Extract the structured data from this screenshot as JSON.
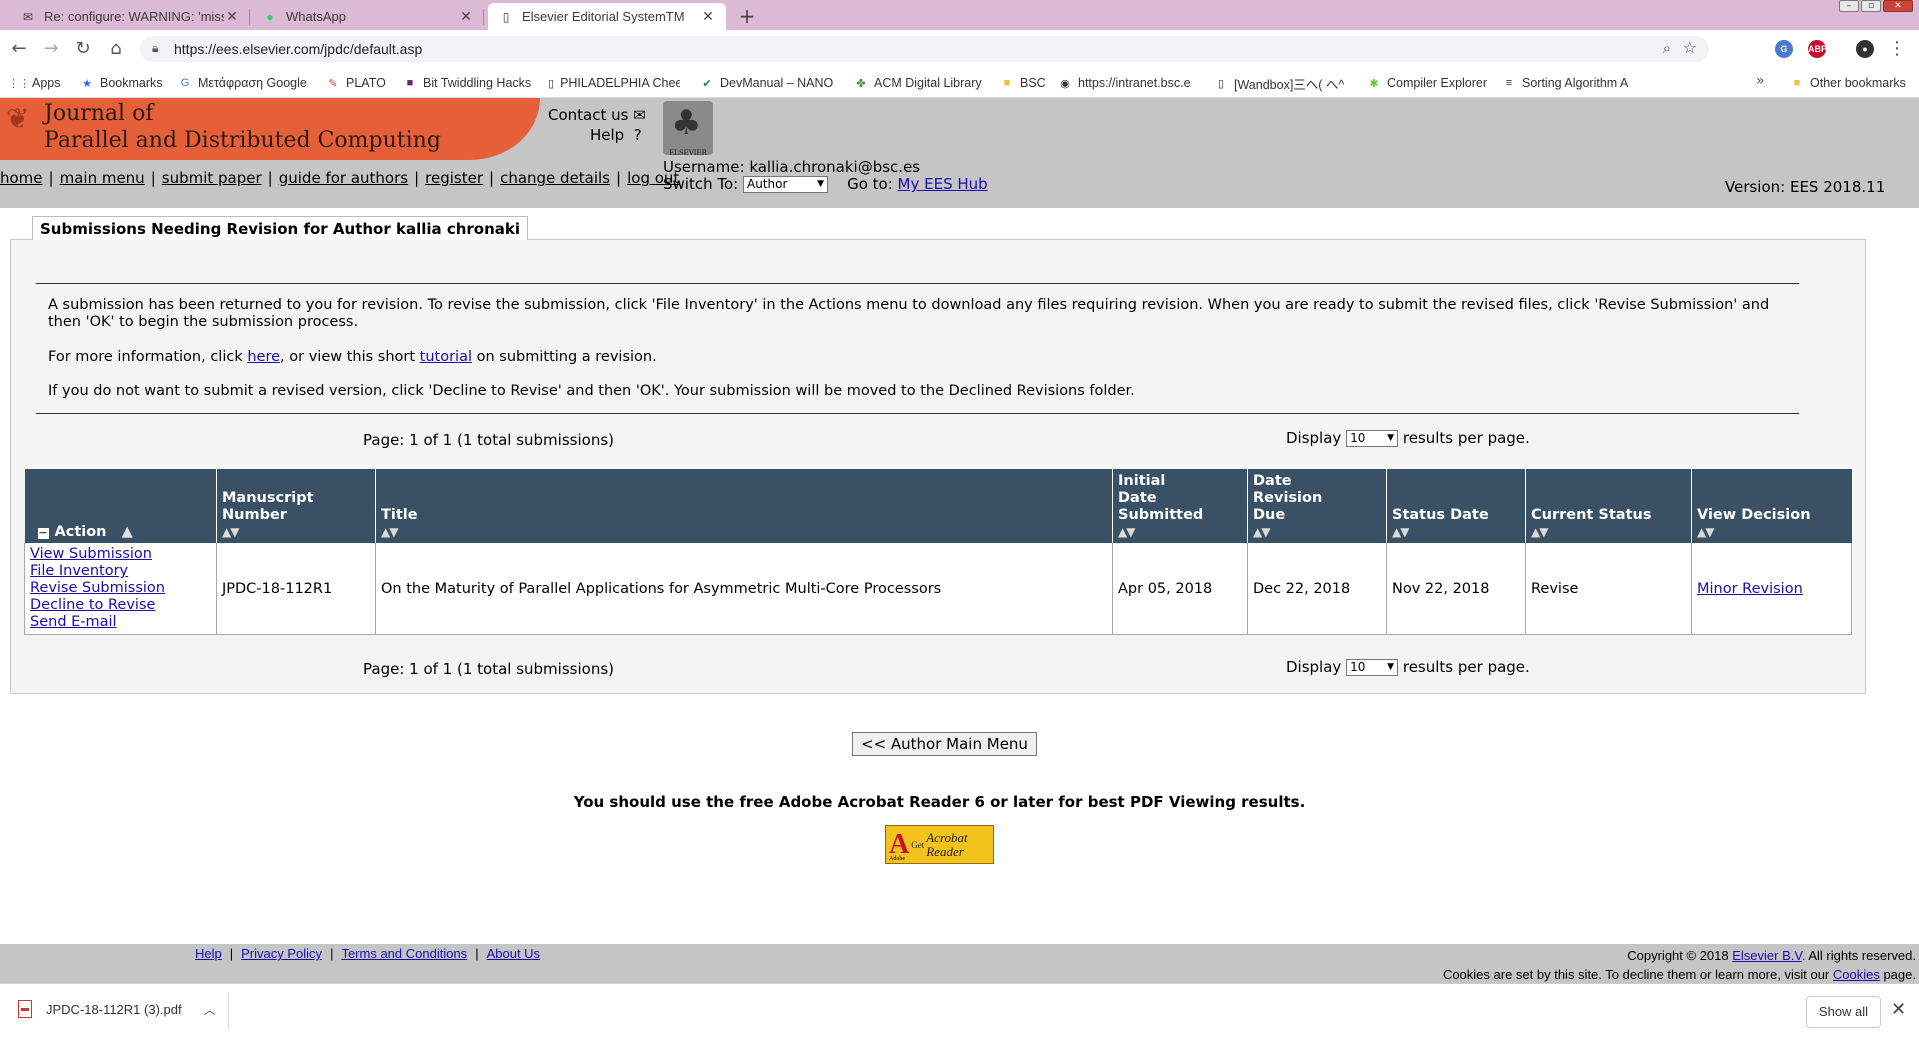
{
  "browser": {
    "tabs": [
      {
        "title": "Re: configure: WARNING: 'missin",
        "icon": "mail-icon"
      },
      {
        "title": "WhatsApp",
        "icon": "whatsapp-icon"
      },
      {
        "title": "Elsevier Editorial SystemTM",
        "icon": "page-icon"
      }
    ],
    "url": "https://ees.elsevier.com/jpdc/default.asp",
    "bookmarks": [
      "Apps",
      "Bookmarks",
      "Μετάφραση Google",
      "PLATO",
      "Bit Twiddling Hacks",
      "PHILADELPHIA Chee",
      "DevManual – NANO",
      "ACM Digital Library",
      "BSC",
      "https://intranet.bsc.e",
      "[Wandbox]三へ( へ^",
      "Compiler Explorer",
      "Sorting Algorithm A"
    ],
    "other_bookmarks": "Other bookmarks",
    "ext_abp": "ABP"
  },
  "header": {
    "journal_line1": "Journal of",
    "journal_line2": "Parallel and Distributed Computing",
    "contact": "Contact us",
    "help": "Help",
    "help_glyph": "?",
    "logo_text": "ELSEVIER",
    "username_label": "Username:",
    "username": "kallia.chronaki@bsc.es",
    "switch_label": "Switch To:",
    "switch_value": "Author",
    "goto_label": "Go to:",
    "hub_link": "My EES Hub",
    "version": "Version: EES 2018.11",
    "nav": [
      "home",
      "main menu",
      "submit paper",
      "guide for authors",
      "register",
      "change details",
      "log out"
    ]
  },
  "content": {
    "title": "Submissions Needing Revision for Author kallia chronaki",
    "para1": "A submission has been returned to you for revision. To revise the submission, click 'File Inventory' in the Actions menu to download any files requiring revision. When you are ready to submit the revised files, click 'Revise Submission' and then 'OK' to begin the submission process.",
    "para2_pre": "For more information, click ",
    "para2_here": "here",
    "para2_mid": ", or view this short ",
    "para2_tutorial": "tutorial",
    "para2_post": " on submitting a revision.",
    "para3": "If you do not want to submit a revised version, click 'Decline to Revise' and then 'OK'. Your submission will be moved to the Declined Revisions folder.",
    "pager": "Page: 1 of 1 (1 total submissions)",
    "display_label": "Display",
    "display_value": "10",
    "per_page": "results per page.",
    "columns": [
      "Action",
      "Manuscript Number",
      "Title",
      "Initial Date Submitted",
      "Date Revision Due",
      "Status Date",
      "Current Status",
      "View Decision"
    ],
    "row": {
      "actions": [
        "View Submission",
        "File Inventory",
        "Revise Submission",
        "Decline to Revise",
        "Send E-mail"
      ],
      "manuscript": "JPDC-18-112R1",
      "title": "On the Maturity of Parallel Applications for Asymmetric Multi-Core Processors",
      "initial_date": "Apr 05, 2018",
      "revision_due": "Dec 22, 2018",
      "status_date": "Nov 22, 2018",
      "status": "Revise",
      "decision": "Minor Revision"
    },
    "main_menu_button": "<< Author Main Menu",
    "adobe_note": "You should use the free Adobe Acrobat Reader 6 or later for best PDF Viewing results.",
    "adobe_logo": {
      "get": "Get",
      "line1": "Acrobat",
      "line2": "Reader",
      "brand": "Adobe"
    }
  },
  "footer": {
    "links": [
      "Help",
      "Privacy Policy",
      "Terms and Conditions",
      "About Us"
    ],
    "copyright_pre": "Copyright © 2018 ",
    "copyright_link": "Elsevier B.V",
    "copyright_post": ". All rights reserved.",
    "cookies_pre": "Cookies are set by this site. To decline them or learn more, visit our ",
    "cookies_link": "Cookies",
    "cookies_post": " page."
  },
  "downloads": {
    "file": "JPDC-18-112R1 (3).pdf",
    "show_all": "Show all"
  },
  "colors": {
    "banner": "#e56039",
    "header_bg": "#c5c5c5",
    "table_header": "#3a5064",
    "tabstrip": "#dcb9d4"
  }
}
